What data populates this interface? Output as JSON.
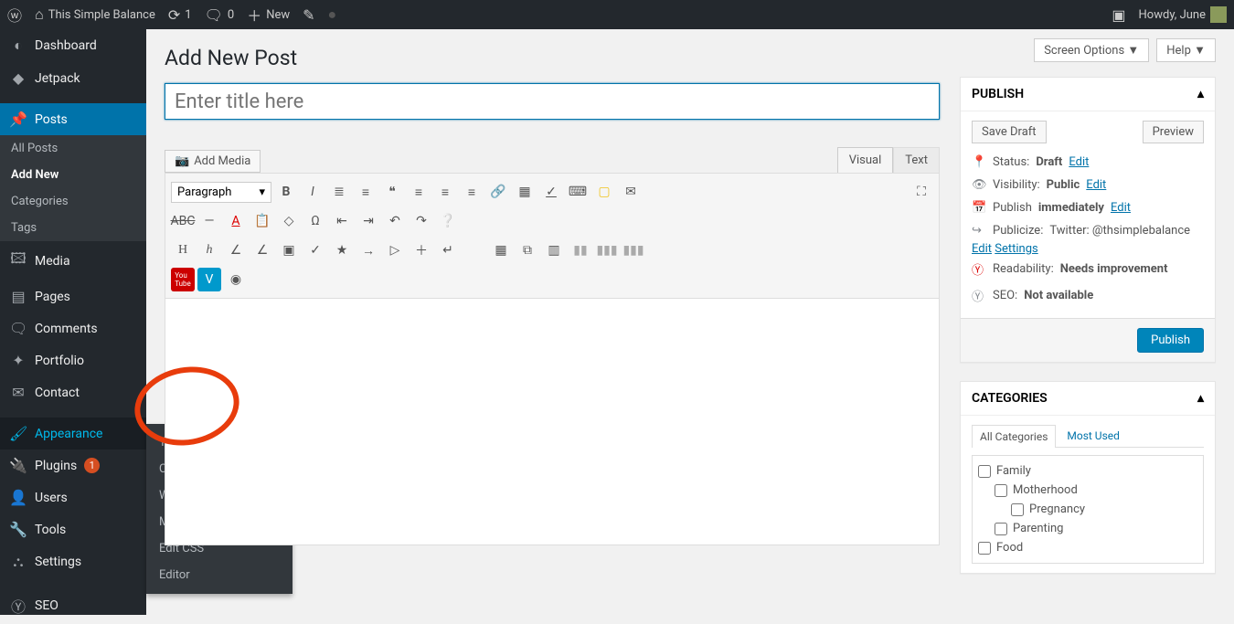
{
  "adminbar": {
    "site_name": "This Simple Balance",
    "updates": "1",
    "comments": "0",
    "new": "New",
    "greeting": "Howdy, June"
  },
  "sidebar": {
    "dashboard": "Dashboard",
    "jetpack": "Jetpack",
    "posts": "Posts",
    "posts_sub": {
      "all": "All Posts",
      "add": "Add New",
      "cats": "Categories",
      "tags": "Tags"
    },
    "media": "Media",
    "pages": "Pages",
    "comments": "Comments",
    "portfolio": "Portfolio",
    "contact": "Contact",
    "appearance": "Appearance",
    "plugins": "Plugins",
    "plugins_badge": "1",
    "users": "Users",
    "tools": "Tools",
    "settings": "Settings",
    "seo": "SEO"
  },
  "flyout": {
    "themes": "Themes",
    "customize": "Customize",
    "widgets": "Widgets",
    "menus": "Menus",
    "editcss": "Edit CSS",
    "editor": "Editor"
  },
  "screen_options": "Screen Options",
  "help": "Help",
  "page_title": "Add New Post",
  "title_placeholder": "Enter title here",
  "add_media": "Add Media",
  "tabs": {
    "visual": "Visual",
    "text": "Text"
  },
  "format_dropdown": "Paragraph",
  "publish": {
    "head": "PUBLISH",
    "save_draft": "Save Draft",
    "preview": "Preview",
    "status_label": "Status:",
    "status_value": "Draft",
    "edit": "Edit",
    "visibility_label": "Visibility:",
    "visibility_value": "Public",
    "publish_label": "Publish",
    "publish_value": "immediately",
    "publicize_label": "Publicize:",
    "publicize_value": "Twitter: @thsimplebalance",
    "settings": "Settings",
    "readability_label": "Readability:",
    "readability_value": "Needs improvement",
    "seo_label": "SEO:",
    "seo_value": "Not available",
    "publish_btn": "Publish"
  },
  "categories": {
    "head": "CATEGORIES",
    "all_tab": "All Categories",
    "most_tab": "Most Used",
    "items": [
      "Family",
      "Motherhood",
      "Pregnancy",
      "Parenting",
      "Food"
    ]
  }
}
